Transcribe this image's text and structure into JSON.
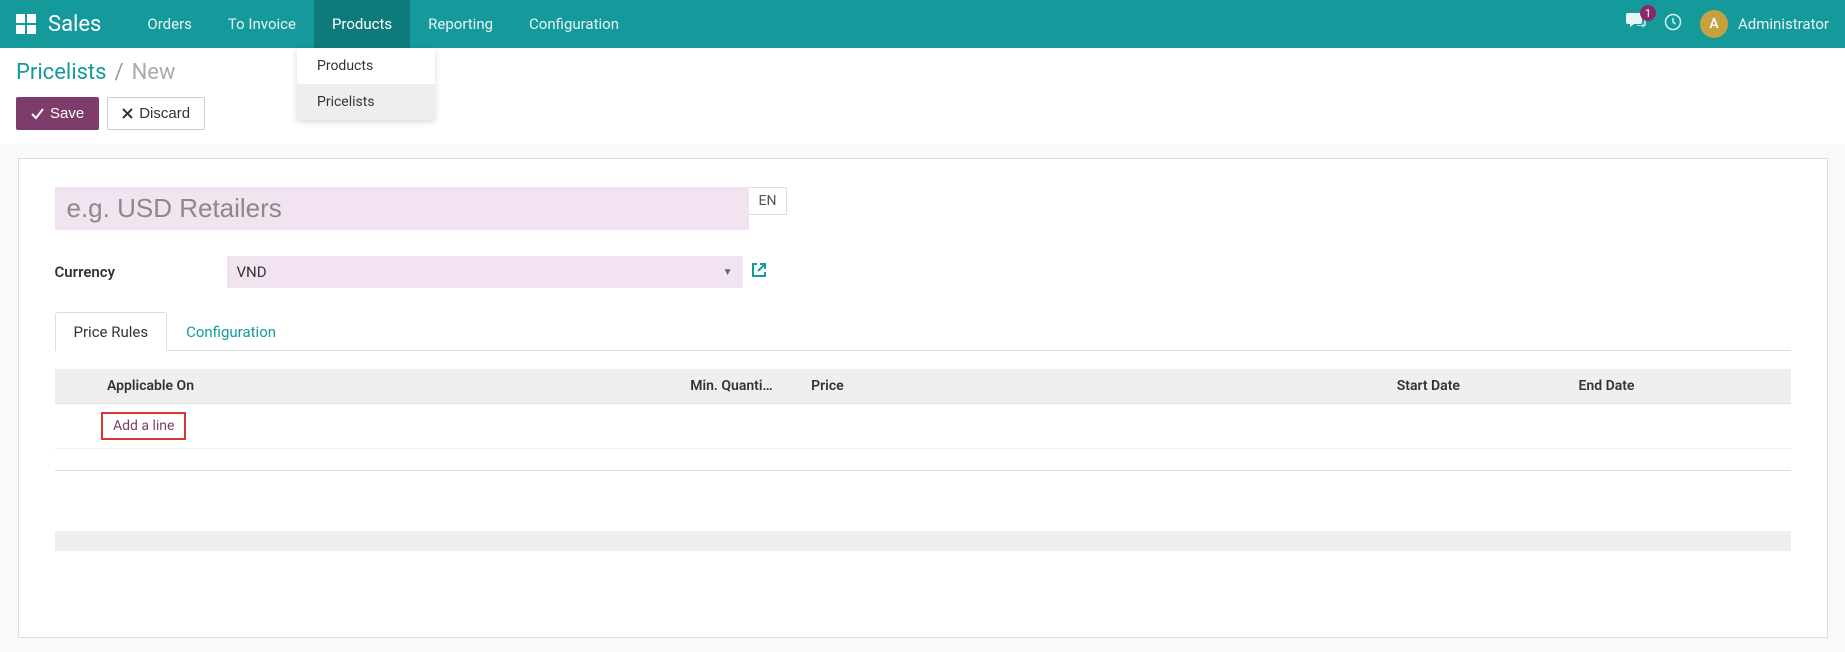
{
  "nav": {
    "brand": "Sales",
    "items": [
      "Orders",
      "To Invoice",
      "Products",
      "Reporting",
      "Configuration"
    ],
    "active_index": 2,
    "chat_badge": "1",
    "user_initial": "A",
    "username": "Administrator"
  },
  "dropdown": {
    "items": [
      "Products",
      "Pricelists"
    ],
    "hover_index": 1
  },
  "breadcrumb": {
    "parent": "Pricelists",
    "current": "New"
  },
  "actions": {
    "save": "Save",
    "discard": "Discard"
  },
  "form": {
    "title_placeholder": "e.g. USD Retailers",
    "title_value": "",
    "lang": "EN",
    "currency_label": "Currency",
    "currency_value": "VND"
  },
  "tabs": {
    "items": [
      "Price Rules",
      "Configuration"
    ],
    "active_index": 0
  },
  "table": {
    "columns": {
      "applicable_on": "Applicable On",
      "min_quantity": "Min. Quanti…",
      "price": "Price",
      "start_date": "Start Date",
      "end_date": "End Date"
    },
    "add_line": "Add a line",
    "rows": []
  }
}
